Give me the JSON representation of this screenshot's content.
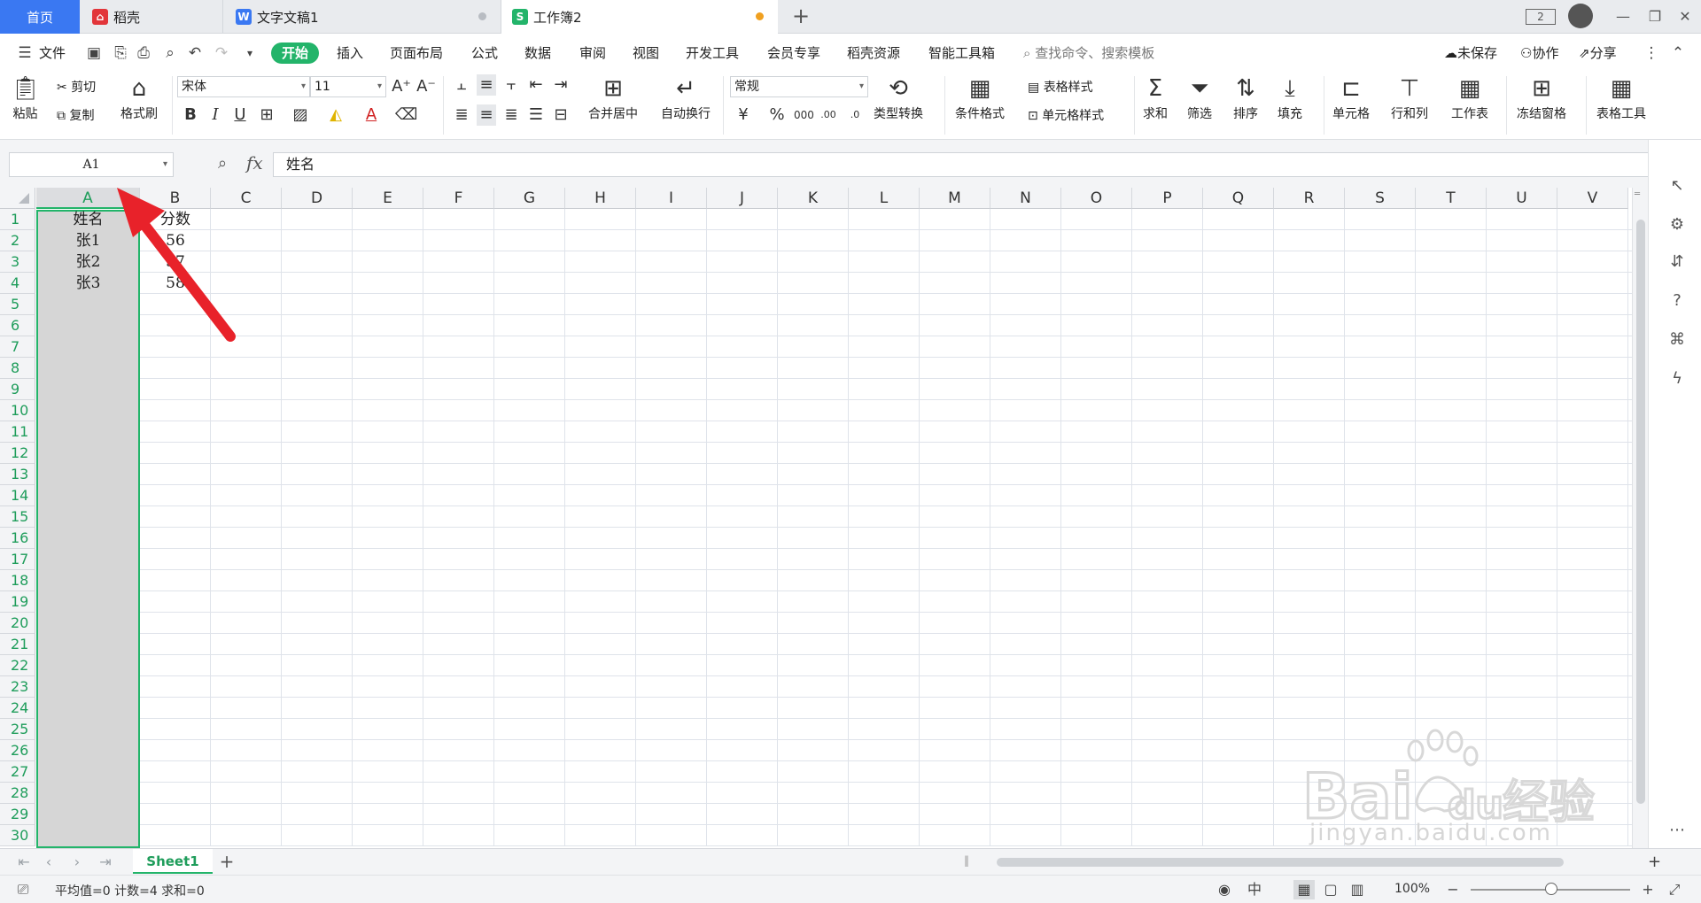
{
  "tabs": {
    "home": "首页",
    "items": [
      {
        "label": "稻壳",
        "color": "#e2353a",
        "icon": "daoke-icon"
      },
      {
        "label": "文字文稿1",
        "color": "#3a78f2",
        "icon": "w-doc-icon"
      },
      {
        "label": "工作簿2",
        "color": "#23b46a",
        "icon": "s-sheet-icon"
      }
    ],
    "window_badge": "2"
  },
  "menu": {
    "file": "文件",
    "items": [
      "开始",
      "插入",
      "页面布局",
      "公式",
      "数据",
      "审阅",
      "视图",
      "开发工具",
      "会员专享",
      "稻壳资源",
      "智能工具箱"
    ],
    "active": "开始",
    "search": "查找命令、搜索模板",
    "unsaved": "未保存",
    "collab": "协作",
    "share": "分享"
  },
  "ribbon": {
    "paste": "粘贴",
    "cut": "剪切",
    "copy": "复制",
    "format_painter": "格式刷",
    "font_name": "宋体",
    "font_size": "11",
    "merge_center": "合并居中",
    "wrap": "自动换行",
    "number_format": "常规",
    "type_convert": "类型转换",
    "cond_format": "条件格式",
    "table_style": "表格样式",
    "cell_style": "单元格样式",
    "sum": "求和",
    "filter": "筛选",
    "sort": "排序",
    "fill": "填充",
    "cell": "单元格",
    "row_col": "行和列",
    "worksheet": "工作表",
    "freeze": "冻结窗格",
    "table_tools": "表格工具"
  },
  "formula_bar": {
    "name_box": "A1",
    "fx": "fx",
    "content": "姓名"
  },
  "grid": {
    "columns": [
      "A",
      "B",
      "C",
      "D",
      "E",
      "F",
      "G",
      "H",
      "I",
      "J",
      "K",
      "L",
      "M",
      "N",
      "O",
      "P",
      "Q",
      "R",
      "S",
      "T",
      "U",
      "V"
    ],
    "selected_column": "A",
    "row_count": 30,
    "cells": [
      {
        "ref": "A1",
        "value": "姓名"
      },
      {
        "ref": "B1",
        "value": "分数"
      },
      {
        "ref": "A2",
        "value": "张1"
      },
      {
        "ref": "B2",
        "value": "56"
      },
      {
        "ref": "A3",
        "value": "张2"
      },
      {
        "ref": "B3",
        "value": "57"
      },
      {
        "ref": "A4",
        "value": "张3"
      },
      {
        "ref": "B4",
        "value": "58"
      }
    ]
  },
  "sheets": {
    "active": "Sheet1"
  },
  "status": {
    "summary": "平均值=0  计数=4  求和=0",
    "zoom": "100%"
  },
  "colors": {
    "accent_green": "#23b46a",
    "tab_blue": "#3a78f2",
    "annotation_red": "#e8222a"
  },
  "watermark": {
    "brand": "Bai",
    "brand2": "du",
    "cn": "经验",
    "url": "jingyan.baidu.com"
  }
}
